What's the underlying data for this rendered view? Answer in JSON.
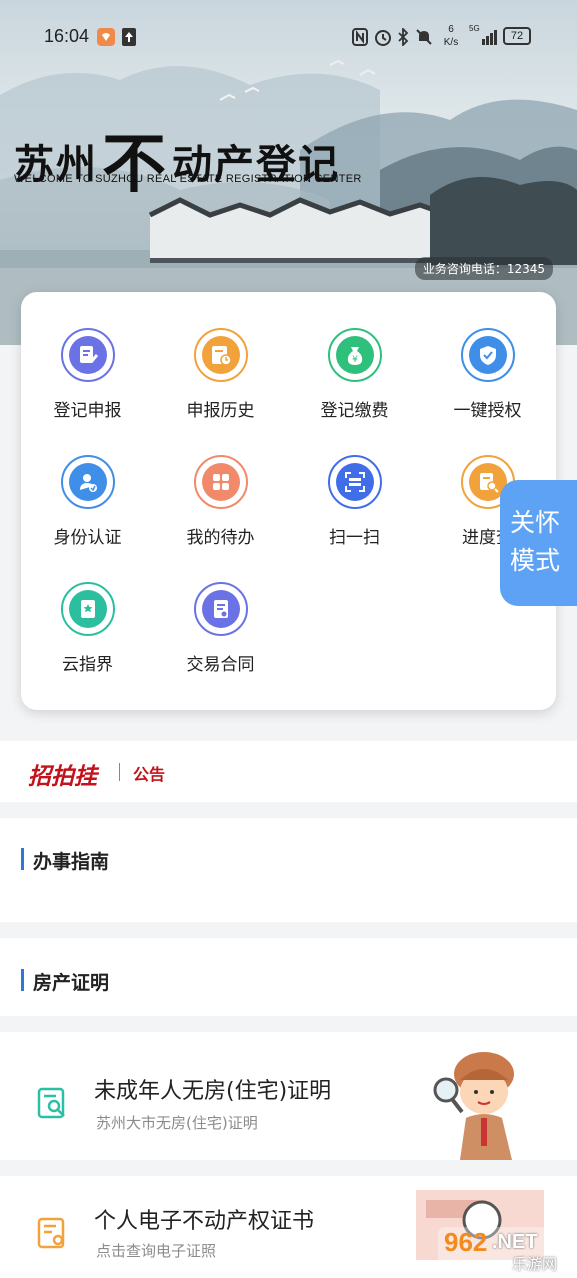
{
  "status_bar": {
    "time": "16:04",
    "net_speed_value": "6",
    "net_speed_unit": "K/s",
    "signal": "5G",
    "battery": "72"
  },
  "banner": {
    "title_part1": "苏州",
    "title_big": "不",
    "title_part2": "动产登记",
    "subtitle": "WELCOME TO SUZHOU REAL ESTATE REGISTRATION CENTER",
    "hotline": "业务咨询电话：12345"
  },
  "grid": [
    {
      "label": "登记申报",
      "icon": "edit-doc-icon",
      "color": "#6a72e6"
    },
    {
      "label": "申报历史",
      "icon": "history-doc-icon",
      "color": "#f2a23a"
    },
    {
      "label": "登记缴费",
      "icon": "money-bag-icon",
      "color": "#2fc07c"
    },
    {
      "label": "一键授权",
      "icon": "shield-check-icon",
      "color": "#3f8ee8"
    },
    {
      "label": "身份认证",
      "icon": "user-verify-icon",
      "color": "#3f8ee8"
    },
    {
      "label": "我的待办",
      "icon": "todo-grid-icon",
      "color": "#f08a6a"
    },
    {
      "label": "扫一扫",
      "icon": "scan-icon",
      "color": "#3f6ee8"
    },
    {
      "label": "进度查",
      "icon": "progress-search-icon",
      "color": "#f2a23a"
    },
    {
      "label": "云指界",
      "icon": "book-star-icon",
      "color": "#2bbf9f"
    },
    {
      "label": "交易合同",
      "icon": "contract-icon",
      "color": "#6a72e6"
    }
  ],
  "care_mode": {
    "line1": "关怀",
    "line2": "模式"
  },
  "notice": {
    "logo": "招拍挂",
    "tag": "公告"
  },
  "sections": {
    "guide": "办事指南",
    "proof": "房产证明"
  },
  "docs": [
    {
      "title": "未成年人无房(住宅)证明",
      "subtitle": "苏州大市无房(住宅)证明",
      "icon": "search-doc-icon",
      "color": "#2bbfa8"
    },
    {
      "title": "个人电子不动产权证书",
      "subtitle": "点击查询电子证照",
      "icon": "certificate-icon",
      "color": "#f2a23a"
    }
  ],
  "watermark": {
    "brand": "962",
    "suffix": ".NET",
    "site": "乐游网"
  }
}
